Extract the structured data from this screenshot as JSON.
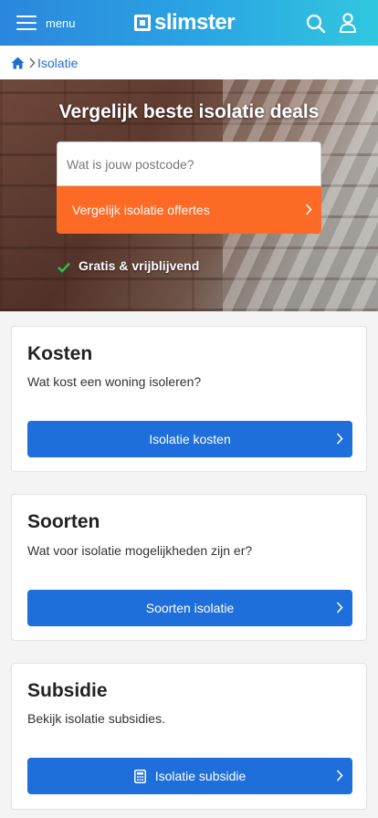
{
  "header": {
    "menu_label": "menu",
    "logo_text": "slimster",
    "icons": {
      "menu": "hamburger-icon",
      "search": "search-icon",
      "user": "user-icon"
    },
    "gradient": [
      "#2b86dd",
      "#31c7df"
    ]
  },
  "breadcrumb": {
    "home_icon": "home-icon",
    "current": "Isolatie"
  },
  "hero": {
    "title": "Vergelijk beste isolatie deals",
    "postcode_placeholder": "Wat is jouw postcode?",
    "postcode_value": "",
    "compare_button": "Vergelijk isolatie offertes",
    "free_note": "Gratis & vrijblijvend",
    "accent_color": "#fc6a26"
  },
  "cards": [
    {
      "title": "Kosten",
      "description": "Wat kost een woning isoleren?",
      "button": "Isolatie kosten"
    },
    {
      "title": "Soorten",
      "description": "Wat voor isolatie mogelijkheden zijn er?",
      "button": "Soorten isolatie"
    },
    {
      "title": "Subsidie",
      "description": "Bekijk isolatie subsidies.",
      "button": "Isolatie subsidie",
      "button_icon": "calculator-icon"
    }
  ],
  "colors": {
    "primary_button": "#1e6fdb",
    "check": "#2fbf4a"
  }
}
